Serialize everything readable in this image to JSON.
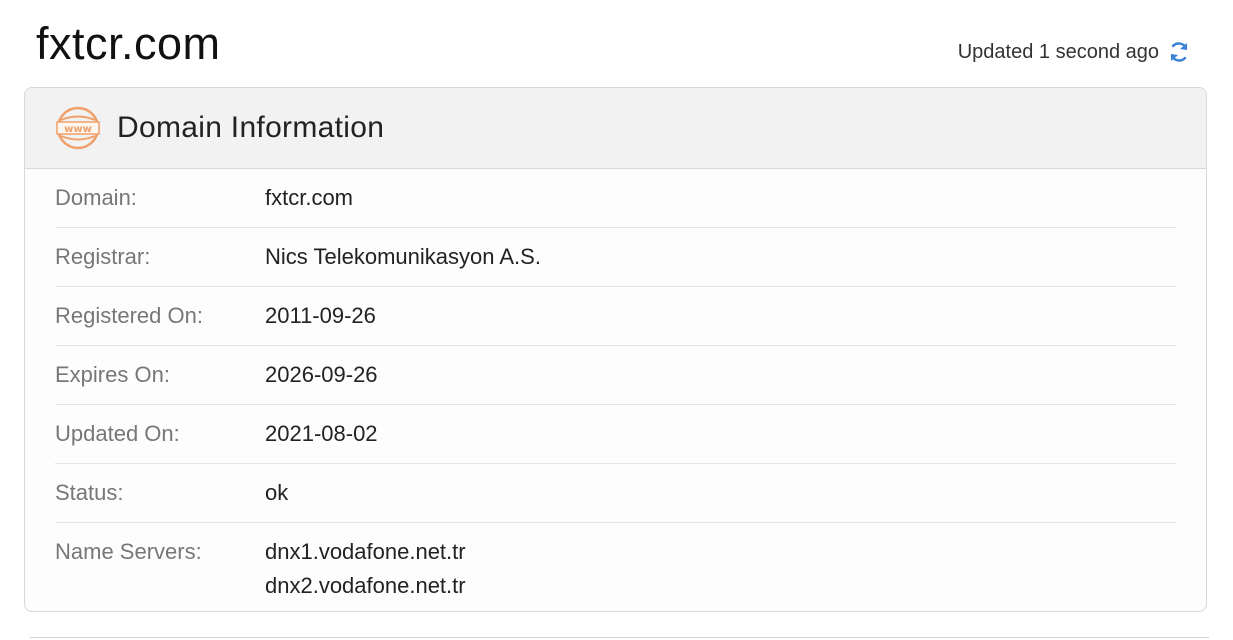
{
  "page": {
    "title": "fxtcr.com",
    "updated_text": "Updated 1 second ago",
    "refresh_icon": "refresh-icon"
  },
  "card": {
    "title": "Domain Information",
    "icon": "www-icon",
    "icon_text": "www",
    "rows": [
      {
        "label": "Domain:",
        "value": "fxtcr.com"
      },
      {
        "label": "Registrar:",
        "value": "Nics Telekomunikasyon A.S."
      },
      {
        "label": "Registered On:",
        "value": "2011-09-26"
      },
      {
        "label": "Expires On:",
        "value": "2026-09-26"
      },
      {
        "label": "Updated On:",
        "value": "2021-08-02"
      },
      {
        "label": "Status:",
        "value": "ok"
      }
    ],
    "name_servers": {
      "label": "Name Servers:",
      "values": [
        "dnx1.vodafone.net.tr",
        "dnx2.vodafone.net.tr"
      ]
    }
  },
  "colors": {
    "accent_orange": "#f0a06a",
    "refresh_blue": "#3b82d6"
  }
}
